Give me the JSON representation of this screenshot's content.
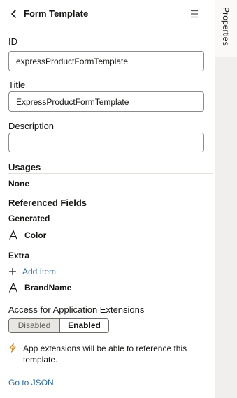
{
  "header": {
    "title": "Form Template"
  },
  "rail": {
    "tab_label": "Properties"
  },
  "id_field": {
    "label": "ID",
    "value": "expressProductFormTemplate"
  },
  "title_field": {
    "label": "Title",
    "value": "ExpressProductFormTemplate"
  },
  "description_field": {
    "label": "Description",
    "value": ""
  },
  "usages": {
    "heading": "Usages",
    "value": "None"
  },
  "referenced_fields": {
    "heading": "Referenced Fields",
    "generated": {
      "label": "Generated",
      "items": [
        "Color"
      ]
    },
    "extra": {
      "label": "Extra",
      "add_label": "Add Item",
      "items": [
        "BrandName"
      ]
    }
  },
  "access": {
    "heading": "Access for Application Extensions",
    "options": [
      "Disabled",
      "Enabled"
    ],
    "selected": "Enabled",
    "note": "App extensions will be able to reference this template."
  },
  "footer": {
    "json_link": "Go to JSON"
  },
  "colors": {
    "accent": "#2b6ba0",
    "bolt": "#c98a1b",
    "rail": "#f1efed"
  },
  "icons": {
    "back": "chevron-left-icon",
    "menu": "hamburger-menu-icon",
    "field": "text-field-a-icon",
    "add": "plus-icon",
    "note": "lightning-bolt-icon"
  }
}
